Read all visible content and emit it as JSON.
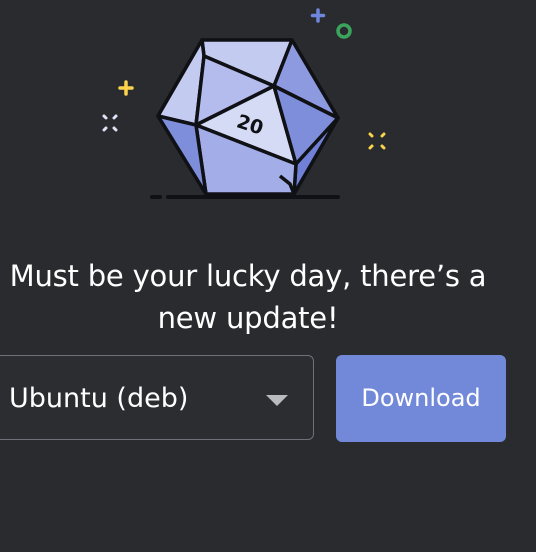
{
  "illustration": {
    "icon": "d20-dice-icon",
    "die_number": "20",
    "colors": {
      "die_light": "#c4cbf1",
      "die_mid": "#9ca8e6",
      "die_dark": "#7e8edb",
      "outline": "#0f1115",
      "star_yellow": "#fcd34d",
      "star_blue": "#6f86dc",
      "ring_green": "#3ba55d",
      "sparkle_white": "#ffffff"
    }
  },
  "message": {
    "line1": "Must be your lucky day, there’s a",
    "line2": "new update!"
  },
  "os_select": {
    "selected": "Ubuntu (deb)",
    "icon": "chevron-down-icon"
  },
  "download_button": {
    "label": "Download",
    "color": "#7289da"
  }
}
